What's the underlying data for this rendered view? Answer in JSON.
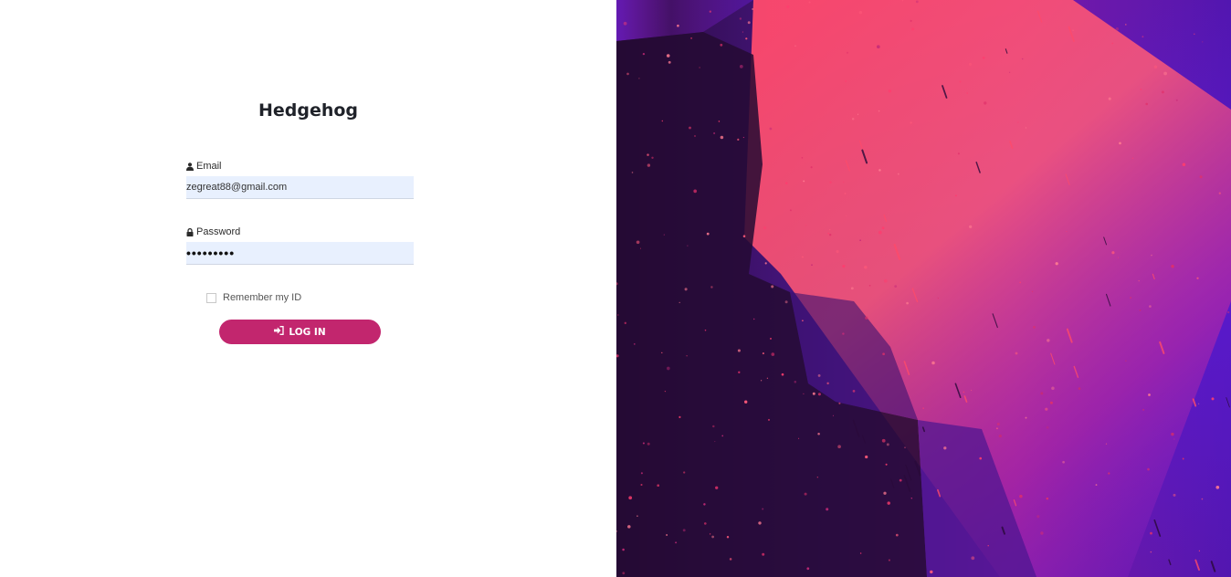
{
  "app": {
    "title": "Hedgehog"
  },
  "form": {
    "email_label": "Email",
    "email_value": "zegreat88@gmail.com",
    "password_label": "Password",
    "password_value": "•••••••••",
    "remember_label": "Remember my ID",
    "remember_checked": false,
    "login_label": "LOG IN"
  },
  "icons": {
    "email": "user-icon",
    "password": "lock-icon",
    "login": "sign-in-icon"
  },
  "colors": {
    "accent": "#c2266e",
    "input_bg": "#e8f0fe",
    "background_art": [
      "#3b0a6b",
      "#e23d6b",
      "#5a16b8"
    ]
  }
}
